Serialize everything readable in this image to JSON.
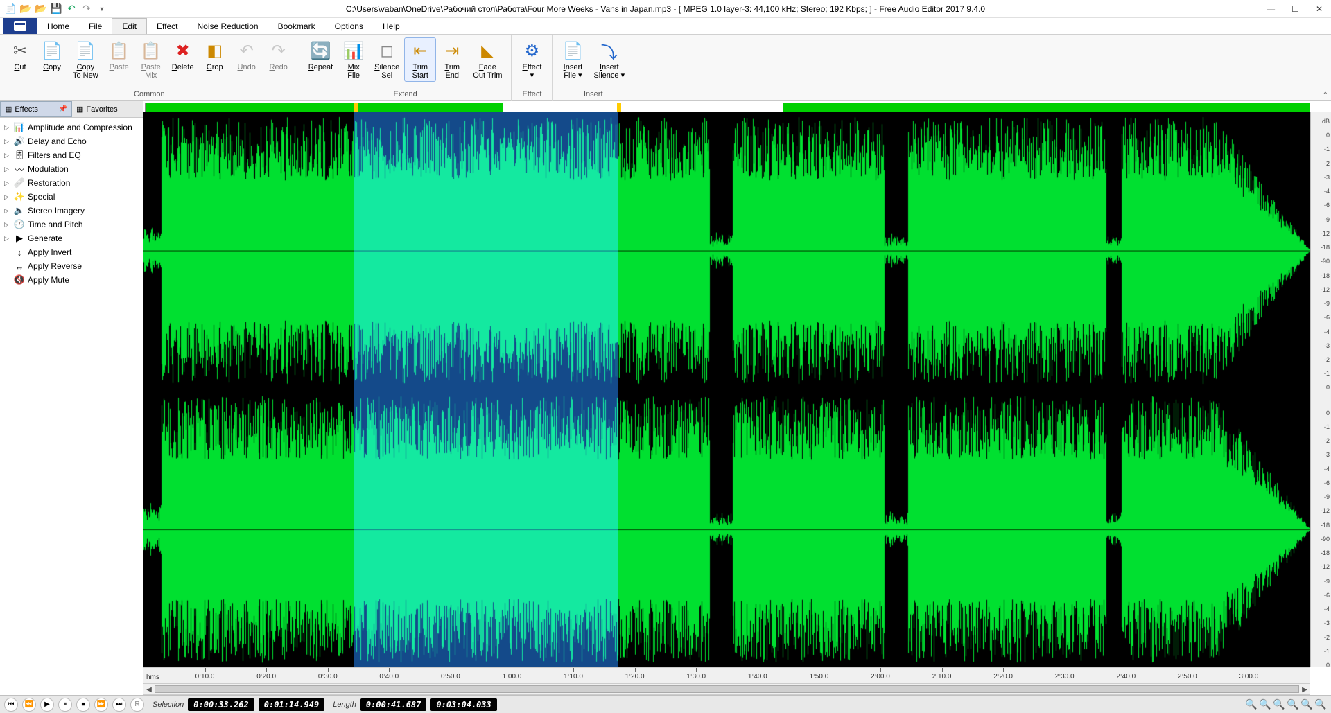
{
  "title": "C:\\Users\\vaban\\OneDrive\\Рабочий стол\\Работа\\Four More Weeks - Vans in Japan.mp3 - [ MPEG 1.0 layer-3: 44,100 kHz; Stereo; 192 Kbps;  ] - Free Audio Editor 2017 9.4.0",
  "menubar": {
    "items": [
      "Home",
      "File",
      "Edit",
      "Effect",
      "Noise Reduction",
      "Bookmark",
      "Options",
      "Help"
    ],
    "active": "Edit"
  },
  "ribbon": {
    "groups": [
      {
        "name": "Common",
        "buttons": [
          {
            "id": "cut",
            "label": "Cut",
            "icon": "✂",
            "color": "#555"
          },
          {
            "id": "copy",
            "label": "Copy",
            "icon": "📄",
            "color": "#5a8"
          },
          {
            "id": "copy-to-new",
            "label": "Copy\nTo New",
            "icon": "📄",
            "color": "#5a8"
          },
          {
            "id": "paste",
            "label": "Paste",
            "icon": "📋",
            "color": "#999",
            "disabled": true
          },
          {
            "id": "paste-mix",
            "label": "Paste\nMix",
            "icon": "📋",
            "color": "#999",
            "disabled": true
          },
          {
            "id": "delete",
            "label": "Delete",
            "icon": "✖",
            "color": "#d22"
          },
          {
            "id": "crop",
            "label": "Crop",
            "icon": "◧",
            "color": "#c80"
          },
          {
            "id": "undo",
            "label": "Undo",
            "icon": "↶",
            "color": "#999",
            "disabled": true
          },
          {
            "id": "redo",
            "label": "Redo",
            "icon": "↷",
            "color": "#999",
            "disabled": true
          }
        ]
      },
      {
        "name": "Extend",
        "buttons": [
          {
            "id": "repeat",
            "label": "Repeat",
            "icon": "🔄",
            "color": "#2a2"
          },
          {
            "id": "mix-file",
            "label": "Mix\nFile",
            "icon": "📊",
            "color": "#26c"
          },
          {
            "id": "silence-sel",
            "label": "Silence\nSel",
            "icon": "◻",
            "color": "#888"
          },
          {
            "id": "trim-start",
            "label": "Trim\nStart",
            "icon": "⇤",
            "color": "#c80",
            "highlighted": true
          },
          {
            "id": "trim-end",
            "label": "Trim\nEnd",
            "icon": "⇥",
            "color": "#c80"
          },
          {
            "id": "fade-out-trim",
            "label": "Fade\nOut Trim",
            "icon": "◣",
            "color": "#c80"
          }
        ]
      },
      {
        "name": "Effect",
        "buttons": [
          {
            "id": "effect",
            "label": "Effect\n▾",
            "icon": "⚙",
            "color": "#26c"
          }
        ]
      },
      {
        "name": "Insert",
        "buttons": [
          {
            "id": "insert-file",
            "label": "Insert\nFile ▾",
            "icon": "📄",
            "color": "#26c"
          },
          {
            "id": "insert-silence",
            "label": "Insert\nSilence ▾",
            "icon": "⤵",
            "color": "#26c"
          }
        ]
      }
    ]
  },
  "sidebar": {
    "tabs": [
      {
        "id": "effects",
        "label": "Effects",
        "active": true
      },
      {
        "id": "favorites",
        "label": "Favorites"
      }
    ],
    "tree": [
      {
        "label": "Amplitude and Compression",
        "icon": "📊",
        "expandable": true
      },
      {
        "label": "Delay and Echo",
        "icon": "🔊",
        "expandable": true
      },
      {
        "label": "Filters and EQ",
        "icon": "🎚",
        "expandable": true
      },
      {
        "label": "Modulation",
        "icon": "〰",
        "expandable": true
      },
      {
        "label": "Restoration",
        "icon": "🩹",
        "expandable": true
      },
      {
        "label": "Special",
        "icon": "✨",
        "expandable": true
      },
      {
        "label": "Stereo Imagery",
        "icon": "🔈",
        "expandable": true
      },
      {
        "label": "Time and Pitch",
        "icon": "🕐",
        "expandable": true
      },
      {
        "label": "Generate",
        "icon": "▶",
        "expandable": true
      },
      {
        "label": "Apply Invert",
        "icon": "↕",
        "expandable": false
      },
      {
        "label": "Apply Reverse",
        "icon": "↔",
        "expandable": false
      },
      {
        "label": "Apply Mute",
        "icon": "🔇",
        "expandable": false
      }
    ]
  },
  "editor": {
    "selection_start_pct": 18.05,
    "selection_end_pct": 40.68,
    "overview_white_start_pct": 30.7,
    "overview_white_end_pct": 54.8,
    "db_scale": [
      "dB",
      "0",
      "-1",
      "-2",
      "-3",
      "-4",
      "-6",
      "-9",
      "-12",
      "-18",
      "-90",
      "-18",
      "-12",
      "-9",
      "-6",
      "-4",
      "-3",
      "-2",
      "-1",
      "0"
    ],
    "timeline": {
      "label": "hms",
      "ticks": [
        "0:10.0",
        "0:20.0",
        "0:30.0",
        "0:40.0",
        "0:50.0",
        "1:00.0",
        "1:10.0",
        "1:20.0",
        "1:30.0",
        "1:40.0",
        "1:50.0",
        "2:00.0",
        "2:10.0",
        "2:20.0",
        "2:30.0",
        "2:40.0",
        "2:50.0",
        "3:00.0"
      ]
    }
  },
  "status": {
    "selection_label": "Selection",
    "sel_start": "0:00:33.262",
    "sel_end": "0:01:14.949",
    "length_label": "Length",
    "len_val": "0:00:41.687",
    "total": "0:03:04.033"
  }
}
